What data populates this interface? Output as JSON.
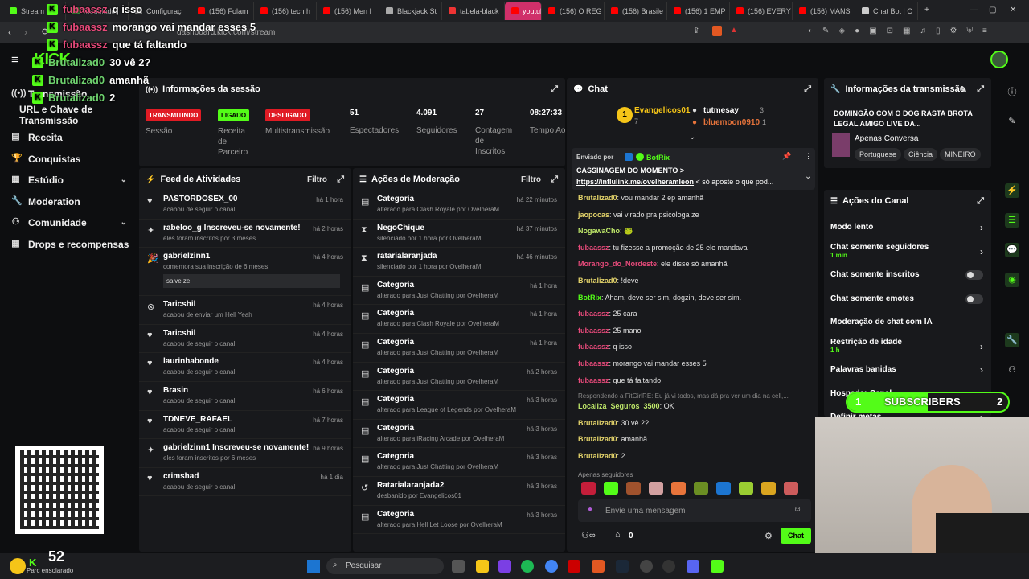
{
  "browser": {
    "tabs": [
      {
        "label": "Stream",
        "color": "#53fc18"
      },
      {
        "label": "Modulador",
        "color": "#4a4"
      },
      {
        "label": "Configuraç",
        "color": "#888"
      },
      {
        "label": "(156) Folam",
        "color": "#f00"
      },
      {
        "label": "(156) tech h",
        "color": "#f00"
      },
      {
        "label": "(156) Men I",
        "color": "#f00"
      },
      {
        "label": "Blackjack St",
        "color": "#aaa"
      },
      {
        "label": "tabela-black",
        "color": "#e33"
      },
      {
        "label": "youtube",
        "color": "#f00"
      },
      {
        "label": "(156) O REG",
        "color": "#f00"
      },
      {
        "label": "(156) Brasile",
        "color": "#f00"
      },
      {
        "label": "(156) 1 EMP",
        "color": "#f00"
      },
      {
        "label": "(156) EVERY",
        "color": "#f00"
      },
      {
        "label": "(156) MANS",
        "color": "#f00"
      },
      {
        "label": "Chat Bot | O",
        "color": "#ccc"
      }
    ],
    "url": "dashboard.kick.com/stream"
  },
  "overlay_chat": [
    {
      "user": "fubaassz",
      "text": "q isso",
      "user_color": "#e64a7a"
    },
    {
      "user": "fubaassz",
      "text": "morango vai mandar esses 5",
      "user_color": "#e64a7a"
    },
    {
      "user": "fubaassz",
      "text": "que tá faltando",
      "user_color": "#e64a7a"
    },
    {
      "user": "Brutalizad0",
      "text": "30 vê 2?",
      "user_color": "#6fd36f"
    },
    {
      "user": "Brutalizad0",
      "text": "amanhã",
      "user_color": "#6fd36f"
    },
    {
      "user": "Brutalizad0",
      "text": "2",
      "user_color": "#6fd36f"
    }
  ],
  "sidebar": {
    "items": [
      {
        "label": "Transmissão",
        "icon": "broadcast-icon"
      },
      {
        "label": "URL e Chave de Transmissão",
        "icon": ""
      },
      {
        "label": "Receita",
        "icon": "receipt-icon"
      },
      {
        "label": "Conquistas",
        "icon": "trophy-icon"
      },
      {
        "label": "Estúdio",
        "icon": "studio-icon"
      },
      {
        "label": "Moderation",
        "icon": "wrench-icon"
      },
      {
        "label": "Comunidade",
        "icon": "users-icon"
      },
      {
        "label": "Drops e recompensas",
        "icon": "grid-icon"
      }
    ]
  },
  "session": {
    "title": "Informações da sessão",
    "badges": [
      {
        "label": "TRANSMITINDO",
        "caption": "Sessão",
        "color": "#e01b24",
        "text_color": "#fff"
      },
      {
        "label": "LIGADO",
        "caption": "Receita de Parceiro",
        "color": "#53fc18",
        "text_color": "#000"
      },
      {
        "label": "DESLIGADO",
        "caption": "Multistransmissão",
        "color": "#e01b24",
        "text_color": "#fff"
      }
    ],
    "stats": [
      {
        "value": "51",
        "label": "Espectadores"
      },
      {
        "value": "4.091",
        "label": "Seguidores"
      },
      {
        "value": "27",
        "label": "Contagem de Inscritos"
      },
      {
        "value": "08:27:33",
        "label": "Tempo Ao Vivo"
      }
    ]
  },
  "feed": {
    "title": "Feed de Atividades",
    "filter": "Filtro",
    "items": [
      {
        "name": "PASTORDOSEX_00",
        "sub": "acabou de seguir o canal",
        "time": "há 1 hora",
        "icon": "heart-icon"
      },
      {
        "name": "rabeloo_g Inscreveu-se novamente!",
        "sub": "eles foram inscritos por 3 meses",
        "time": "há 2 horas",
        "icon": "star-icon"
      },
      {
        "name": "gabrielzinn1",
        "sub": "comemora sua inscrição de 6 meses!",
        "time": "há 4 horas",
        "icon": "party-icon",
        "msg": "salve ze"
      },
      {
        "name": "Taricshil",
        "sub": "acabou de enviar um Hell Yeah",
        "time": "há 4 horas",
        "icon": "kick-icon"
      },
      {
        "name": "Taricshil",
        "sub": "acabou de seguir o canal",
        "time": "há 4 horas",
        "icon": "heart-icon"
      },
      {
        "name": "laurinhabonde",
        "sub": "acabou de seguir o canal",
        "time": "há 4 horas",
        "icon": "heart-icon"
      },
      {
        "name": "Brasin",
        "sub": "acabou de seguir o canal",
        "time": "há 6 horas",
        "icon": "heart-icon"
      },
      {
        "name": "TDNEVE_RAFAEL",
        "sub": "acabou de seguir o canal",
        "time": "há 7 horas",
        "icon": "heart-icon"
      },
      {
        "name": "gabrielzinn1 Inscreveu-se novamente!",
        "sub": "eles foram inscritos por 6 meses",
        "time": "há 9 horas",
        "icon": "star-icon"
      },
      {
        "name": "crimshad",
        "sub": "acabou de seguir o canal",
        "time": "há 1 dia",
        "icon": "heart-icon"
      }
    ]
  },
  "moderation": {
    "title": "Ações de Moderação",
    "filter": "Filtro",
    "items": [
      {
        "name": "Categoria",
        "sub": "alterado para Clash Royale por OvelheraM",
        "time": "há 22 minutos",
        "icon": "category-icon"
      },
      {
        "name": "NegoChique",
        "sub": "silenciado por 1 hora por OvelheraM",
        "time": "há 37 minutos",
        "icon": "hourglass-icon"
      },
      {
        "name": "ratarialaranjada",
        "sub": "silenciado por 1 hora por OvelheraM",
        "time": "há 46 minutos",
        "icon": "hourglass-icon"
      },
      {
        "name": "Categoria",
        "sub": "alterado para Just Chatting por OvelheraM",
        "time": "há 1 hora",
        "icon": "category-icon"
      },
      {
        "name": "Categoria",
        "sub": "alterado para Clash Royale por OvelheraM",
        "time": "há 1 hora",
        "icon": "category-icon"
      },
      {
        "name": "Categoria",
        "sub": "alterado para Just Chatting por OvelheraM",
        "time": "há 1 hora",
        "icon": "category-icon"
      },
      {
        "name": "Categoria",
        "sub": "alterado para Just Chatting por OvelheraM",
        "time": "há 2 horas",
        "icon": "category-icon"
      },
      {
        "name": "Categoria",
        "sub": "alterado para League of Legends por OvelheraM",
        "time": "há 3 horas",
        "icon": "category-icon"
      },
      {
        "name": "Categoria",
        "sub": "alterado para iRacing Arcade por OvelheraM",
        "time": "há 3 horas",
        "icon": "category-icon"
      },
      {
        "name": "Categoria",
        "sub": "alterado para Just Chatting por OvelheraM",
        "time": "há 3 horas",
        "icon": "category-icon"
      },
      {
        "name": "Ratarialaranjada2",
        "sub": "desbanido por Evangelicos01",
        "time": "há 3 horas",
        "icon": "undo-icon"
      },
      {
        "name": "Categoria",
        "sub": "alterado para Hell Let Loose por OvelheraM",
        "time": "há 3 horas",
        "icon": "category-icon"
      }
    ]
  },
  "chat": {
    "title": "Chat",
    "top": [
      {
        "user": "Evangelicos01",
        "count": "7"
      },
      {
        "user": "tutmesay",
        "count": "3"
      },
      {
        "user": "bluemoon0910",
        "count": "1"
      }
    ],
    "pinned": {
      "by": "Enviado por",
      "bot": "BotRix",
      "line1": "CASSINAGEM DO MOMENTO >",
      "link": "https://influlink.me/ovelheramleon",
      "rest": " < só aposte o que pod..."
    },
    "messages": [
      {
        "user": "Brutalizad0",
        "text": "vou mandar 2 ep amanhã",
        "color": "#e3d36a"
      },
      {
        "user": "jaopocas",
        "text": "vai virado pra psicologa ze",
        "color": "#e3d36a"
      },
      {
        "user": "NogawaCho",
        "text": "🐸",
        "color": "#bfe86a"
      },
      {
        "user": "fubaassz",
        "text": "tu fizesse a promoção de 25 ele mandava",
        "color": "#e64a7a"
      },
      {
        "user": "Morango_do_Nordeste",
        "text": "ele disse só amanhã",
        "color": "#e64a7a"
      },
      {
        "user": "Brutalizad0",
        "text": "!deve",
        "color": "#e3d36a"
      },
      {
        "user": "BotRix",
        "text": "Aham, deve ser sim, dogzin, deve ser sim.",
        "color": "#53fc18"
      },
      {
        "user": "fubaassz",
        "text": "25 cara",
        "color": "#e64a7a"
      },
      {
        "user": "fubaassz",
        "text": "25 mano",
        "color": "#e64a7a"
      },
      {
        "user": "fubaassz",
        "text": "q isso",
        "color": "#e64a7a"
      },
      {
        "user": "fubaassz",
        "text": "morango vai mandar esses 5",
        "color": "#e64a7a"
      },
      {
        "user": "fubaassz",
        "text": "que tá faltando",
        "color": "#e64a7a"
      }
    ],
    "reply_note": "Respondendo a FitGirlRE: Eu já vi todos, mas dá pra ver um dia na cell,...",
    "messages2": [
      {
        "user": "Localiza_Seguros_3500",
        "text": "OK",
        "color": "#bfe86a"
      },
      {
        "user": "Brutalizad0",
        "text": "30 vê 2?",
        "color": "#e3d36a"
      },
      {
        "user": "Brutalizad0",
        "text": "amanhã",
        "color": "#e3d36a"
      },
      {
        "user": "Brutalizad0",
        "text": "2",
        "color": "#e3d36a"
      }
    ],
    "followers_only": "Apenas seguidores",
    "placeholder": "Envie uma mensagem",
    "points": "0",
    "send_label": "Chat"
  },
  "stream_info": {
    "title": "Informações da transmissão",
    "stream_title": "DOMINGÃO COM O DOG RASTA BROTA LEGAL AMIGO LIVE DA...",
    "category": "Apenas Conversa",
    "tags": [
      "Portuguese",
      "Ciência",
      "MINEIRO"
    ]
  },
  "channel_actions": {
    "title": "Ações do Canal",
    "items": [
      {
        "label": "Modo lento",
        "sub": "",
        "type": "chevron"
      },
      {
        "label": "Chat somente seguidores",
        "sub": "1 min",
        "type": "chevron"
      },
      {
        "label": "Chat somente inscritos",
        "sub": "",
        "type": "toggle"
      },
      {
        "label": "Chat somente emotes",
        "sub": "",
        "type": "toggle"
      },
      {
        "label": "Moderação de chat com IA",
        "sub": "",
        "type": "none"
      },
      {
        "label": "Restrição de idade",
        "sub": "1 h",
        "type": "chevron"
      },
      {
        "label": "Palavras banidas",
        "sub": "",
        "type": "chevron"
      },
      {
        "label": "Hospedar Canal",
        "sub": "",
        "type": "none"
      },
      {
        "label": "Definir metas",
        "sub": "",
        "type": "chevron"
      }
    ]
  },
  "subscribers_goal": {
    "left": "1",
    "label": "SUBSCRIBERS",
    "right": "2"
  },
  "weather": {
    "temp": "52",
    "desc": "Parc ensolarado"
  },
  "taskbar": {
    "search": "Pesquisar"
  }
}
